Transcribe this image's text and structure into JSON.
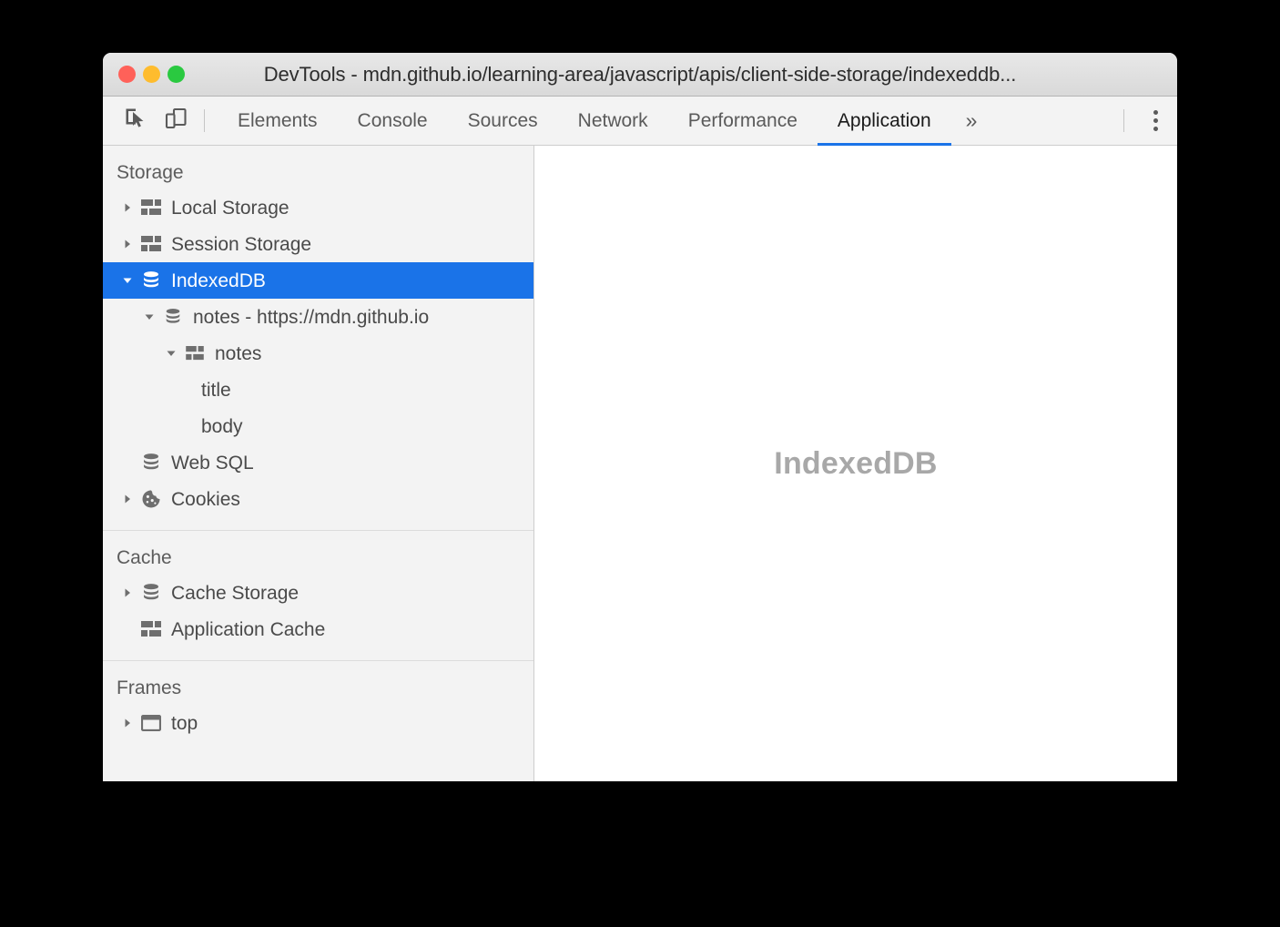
{
  "window": {
    "title": "DevTools - mdn.github.io/learning-area/javascript/apis/client-side-storage/indexeddb...",
    "traffic_lights": {
      "close": "close",
      "minimize": "minimize",
      "maximize": "maximize"
    },
    "colors": {
      "close": "#ff6159",
      "minimize": "#febc2e",
      "maximize": "#2ac940",
      "accent": "#1a73e8",
      "sidebar_bg": "#f3f3f3",
      "main_bg": "#ffffff",
      "selection_bg": "#1a73e8",
      "text": "#4a4a4a",
      "placeholder_text": "#a8a8a8"
    }
  },
  "toolbar": {
    "inspect_icon": "inspect-element-icon",
    "device_icon": "device-toolbar-icon",
    "more_tabs_label": "»",
    "kebab_label": "more-options",
    "tabs": [
      {
        "label": "Elements",
        "active": false
      },
      {
        "label": "Console",
        "active": false
      },
      {
        "label": "Sources",
        "active": false
      },
      {
        "label": "Network",
        "active": false
      },
      {
        "label": "Performance",
        "active": false
      },
      {
        "label": "Application",
        "active": true
      }
    ]
  },
  "sidebar": {
    "sections": [
      {
        "title": "Storage",
        "items": [
          {
            "label": "Local Storage",
            "icon": "table-icon",
            "twisty": "collapsed",
            "depth": 0,
            "selected": false
          },
          {
            "label": "Session Storage",
            "icon": "table-icon",
            "twisty": "collapsed",
            "depth": 0,
            "selected": false
          },
          {
            "label": "IndexedDB",
            "icon": "database-icon",
            "twisty": "expanded",
            "depth": 0,
            "selected": true
          },
          {
            "label": "notes - https://mdn.github.io",
            "icon": "database-icon",
            "twisty": "expanded",
            "depth": 1,
            "selected": false
          },
          {
            "label": "notes",
            "icon": "table-icon",
            "twisty": "expanded",
            "depth": 2,
            "selected": false
          },
          {
            "label": "title",
            "icon": "none",
            "twisty": "none",
            "depth": 3,
            "selected": false
          },
          {
            "label": "body",
            "icon": "none",
            "twisty": "none",
            "depth": 3,
            "selected": false
          },
          {
            "label": "Web SQL",
            "icon": "database-icon",
            "twisty": "none",
            "depth": 0,
            "selected": false
          },
          {
            "label": "Cookies",
            "icon": "cookie-icon",
            "twisty": "collapsed",
            "depth": 0,
            "selected": false
          }
        ]
      },
      {
        "title": "Cache",
        "items": [
          {
            "label": "Cache Storage",
            "icon": "database-icon",
            "twisty": "collapsed",
            "depth": 0,
            "selected": false
          },
          {
            "label": "Application Cache",
            "icon": "table-icon",
            "twisty": "none",
            "depth": 0,
            "selected": false
          }
        ]
      },
      {
        "title": "Frames",
        "items": [
          {
            "label": "top",
            "icon": "frame-icon",
            "twisty": "collapsed",
            "depth": 0,
            "selected": false
          }
        ]
      }
    ]
  },
  "main": {
    "placeholder": "IndexedDB"
  }
}
